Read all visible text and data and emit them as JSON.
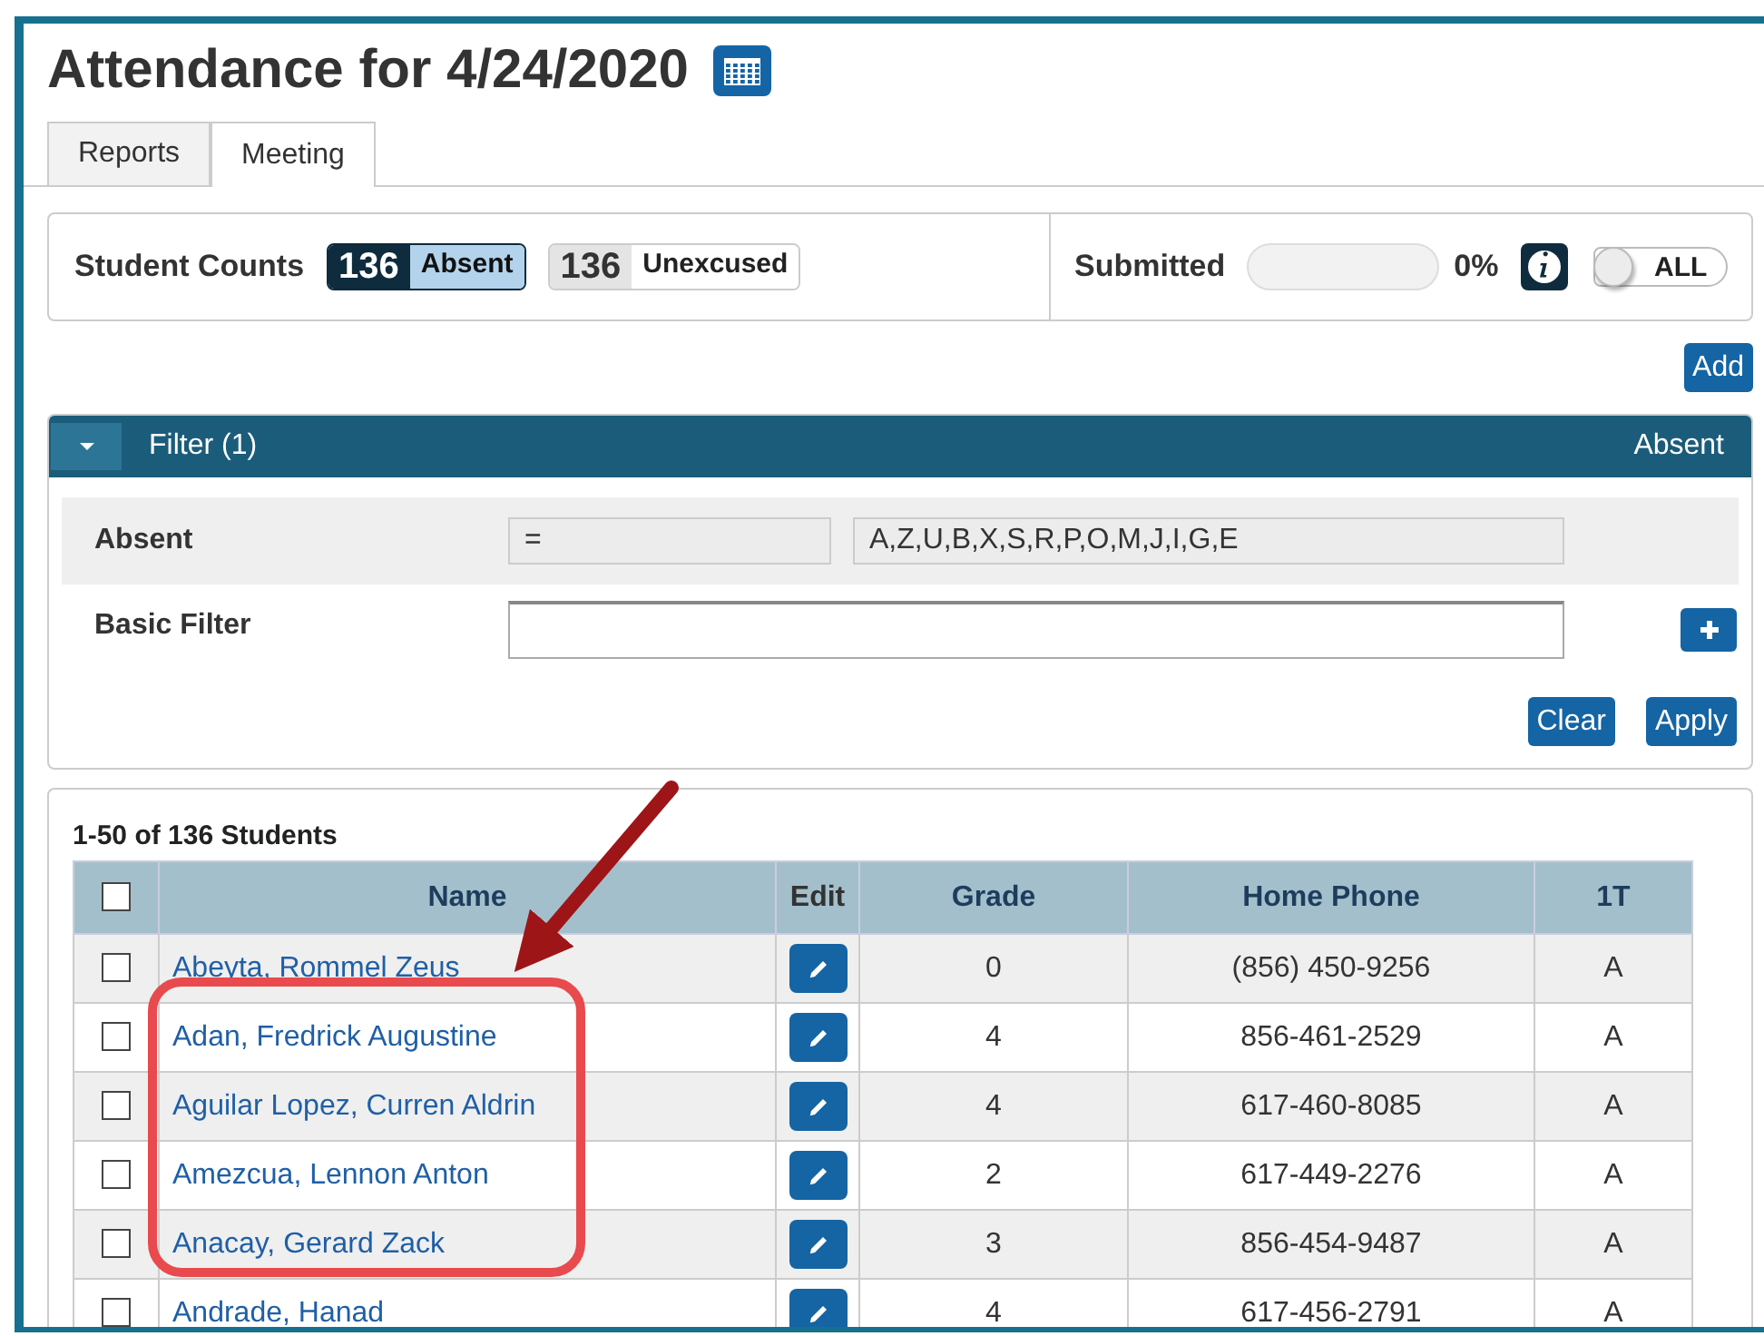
{
  "title": "Attendance for 4/24/2020",
  "tabs": [
    {
      "label": "Reports",
      "selected": false
    },
    {
      "label": "Meeting",
      "selected": true
    }
  ],
  "counts": {
    "label": "Student Counts",
    "badges": [
      {
        "count": "136",
        "label": "Absent",
        "selected": true
      },
      {
        "count": "136",
        "label": "Unexcused",
        "selected": false
      }
    ]
  },
  "submitted": {
    "label": "Submitted",
    "level": 0,
    "reading": "0%",
    "toggle": {
      "label": "ALL",
      "on": false
    }
  },
  "add_button": "Add",
  "filter": {
    "title": "Filter (1)",
    "expanded": true,
    "right_label": "Absent",
    "rows": [
      {
        "kind": "fixed",
        "label": "Absent",
        "operator": "=",
        "value": "A,Z,U,B,X,S,R,P,O,M,J,I,G,E"
      },
      {
        "kind": "input",
        "label": "Basic Filter"
      }
    ],
    "buttons": [
      "Clear",
      "Apply"
    ]
  },
  "students": {
    "summary": "1-50 of 136 Students",
    "select_all_checked": false,
    "columns": [
      "Name",
      "Edit",
      "Grade",
      "Home Phone",
      "1T"
    ],
    "rows": [
      {
        "checked": false,
        "name": "Abeyta, Rommel Zeus",
        "grade": "0",
        "phone": "(856) 450-9256",
        "col_1t": "A"
      },
      {
        "checked": false,
        "name": "Adan, Fredrick Augustine",
        "grade": "4",
        "phone": "856-461-2529",
        "col_1t": "A"
      },
      {
        "checked": false,
        "name": "Aguilar Lopez, Curren Aldrin",
        "grade": "4",
        "phone": "617-460-8085",
        "col_1t": "A"
      },
      {
        "checked": false,
        "name": "Amezcua, Lennon Anton",
        "grade": "2",
        "phone": "617-449-2276",
        "col_1t": "A"
      },
      {
        "checked": false,
        "name": "Anacay, Gerard Zack",
        "grade": "3",
        "phone": "856-454-9487",
        "col_1t": "A"
      },
      {
        "checked": false,
        "name": "Andrade, Hanad",
        "grade": "4",
        "phone": "617-456-2791",
        "col_1t": "A"
      }
    ]
  },
  "annotation": {
    "arrow": true,
    "circle": true
  }
}
